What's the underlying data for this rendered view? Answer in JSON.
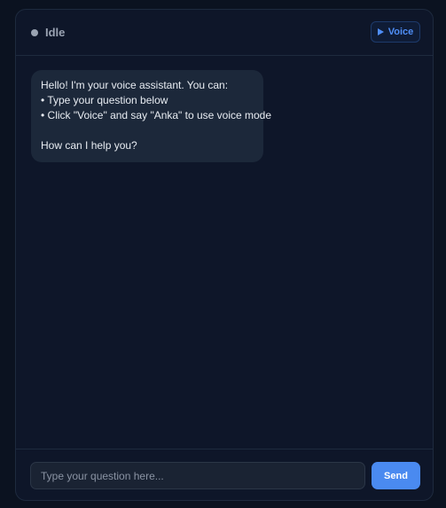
{
  "header": {
    "status": "Idle",
    "voice_label": "Voice"
  },
  "messages": [
    {
      "role": "assistant",
      "lines": [
        "Hello! I'm your voice assistant. You can:",
        "• Type your question below",
        "• Click \"Voice\" and say \"Anka\" to use voice mode",
        "",
        "How can I help you?"
      ]
    }
  ],
  "composer": {
    "placeholder": "Type your question here...",
    "value": "",
    "send_label": "Send"
  },
  "colors": {
    "accent": "#4a8af0",
    "status_idle": "#9aa3b2"
  },
  "icons": {
    "status": "status-dot-icon",
    "voice": "play-icon"
  }
}
